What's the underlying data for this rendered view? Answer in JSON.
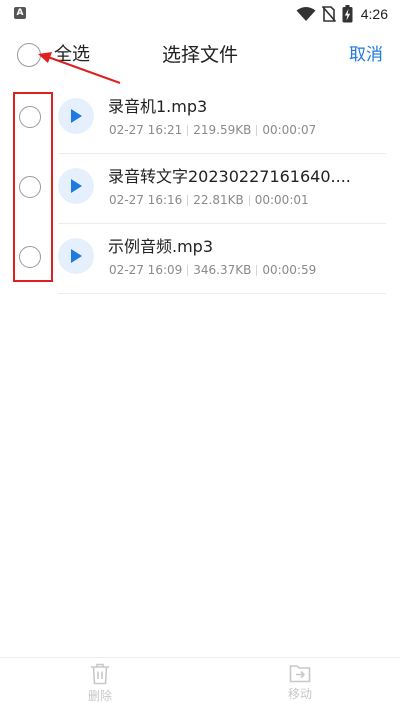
{
  "status_bar": {
    "app_indicator": "A",
    "time": "4:26",
    "icons": [
      "wifi-icon",
      "no-sim-icon",
      "battery-charging-icon"
    ]
  },
  "header": {
    "select_all_label": "全选",
    "title": "选择文件",
    "cancel_label": "取消"
  },
  "files": [
    {
      "name": "录音机1.mp3",
      "date": "02-27 16:21",
      "size": "219.59KB",
      "duration": "00:00:07"
    },
    {
      "name": "录音转文字20230227161640....",
      "date": "02-27 16:16",
      "size": "22.81KB",
      "duration": "00:00:01"
    },
    {
      "name": "示例音频.mp3",
      "date": "02-27 16:09",
      "size": "346.37KB",
      "duration": "00:00:59"
    }
  ],
  "toolbar": {
    "delete_label": "删除",
    "move_label": "移动"
  },
  "colors": {
    "accent": "#1f7ae0",
    "play_bg": "#e6f0fd",
    "annotation": "#e02020",
    "disabled": "#c8c8c8"
  }
}
